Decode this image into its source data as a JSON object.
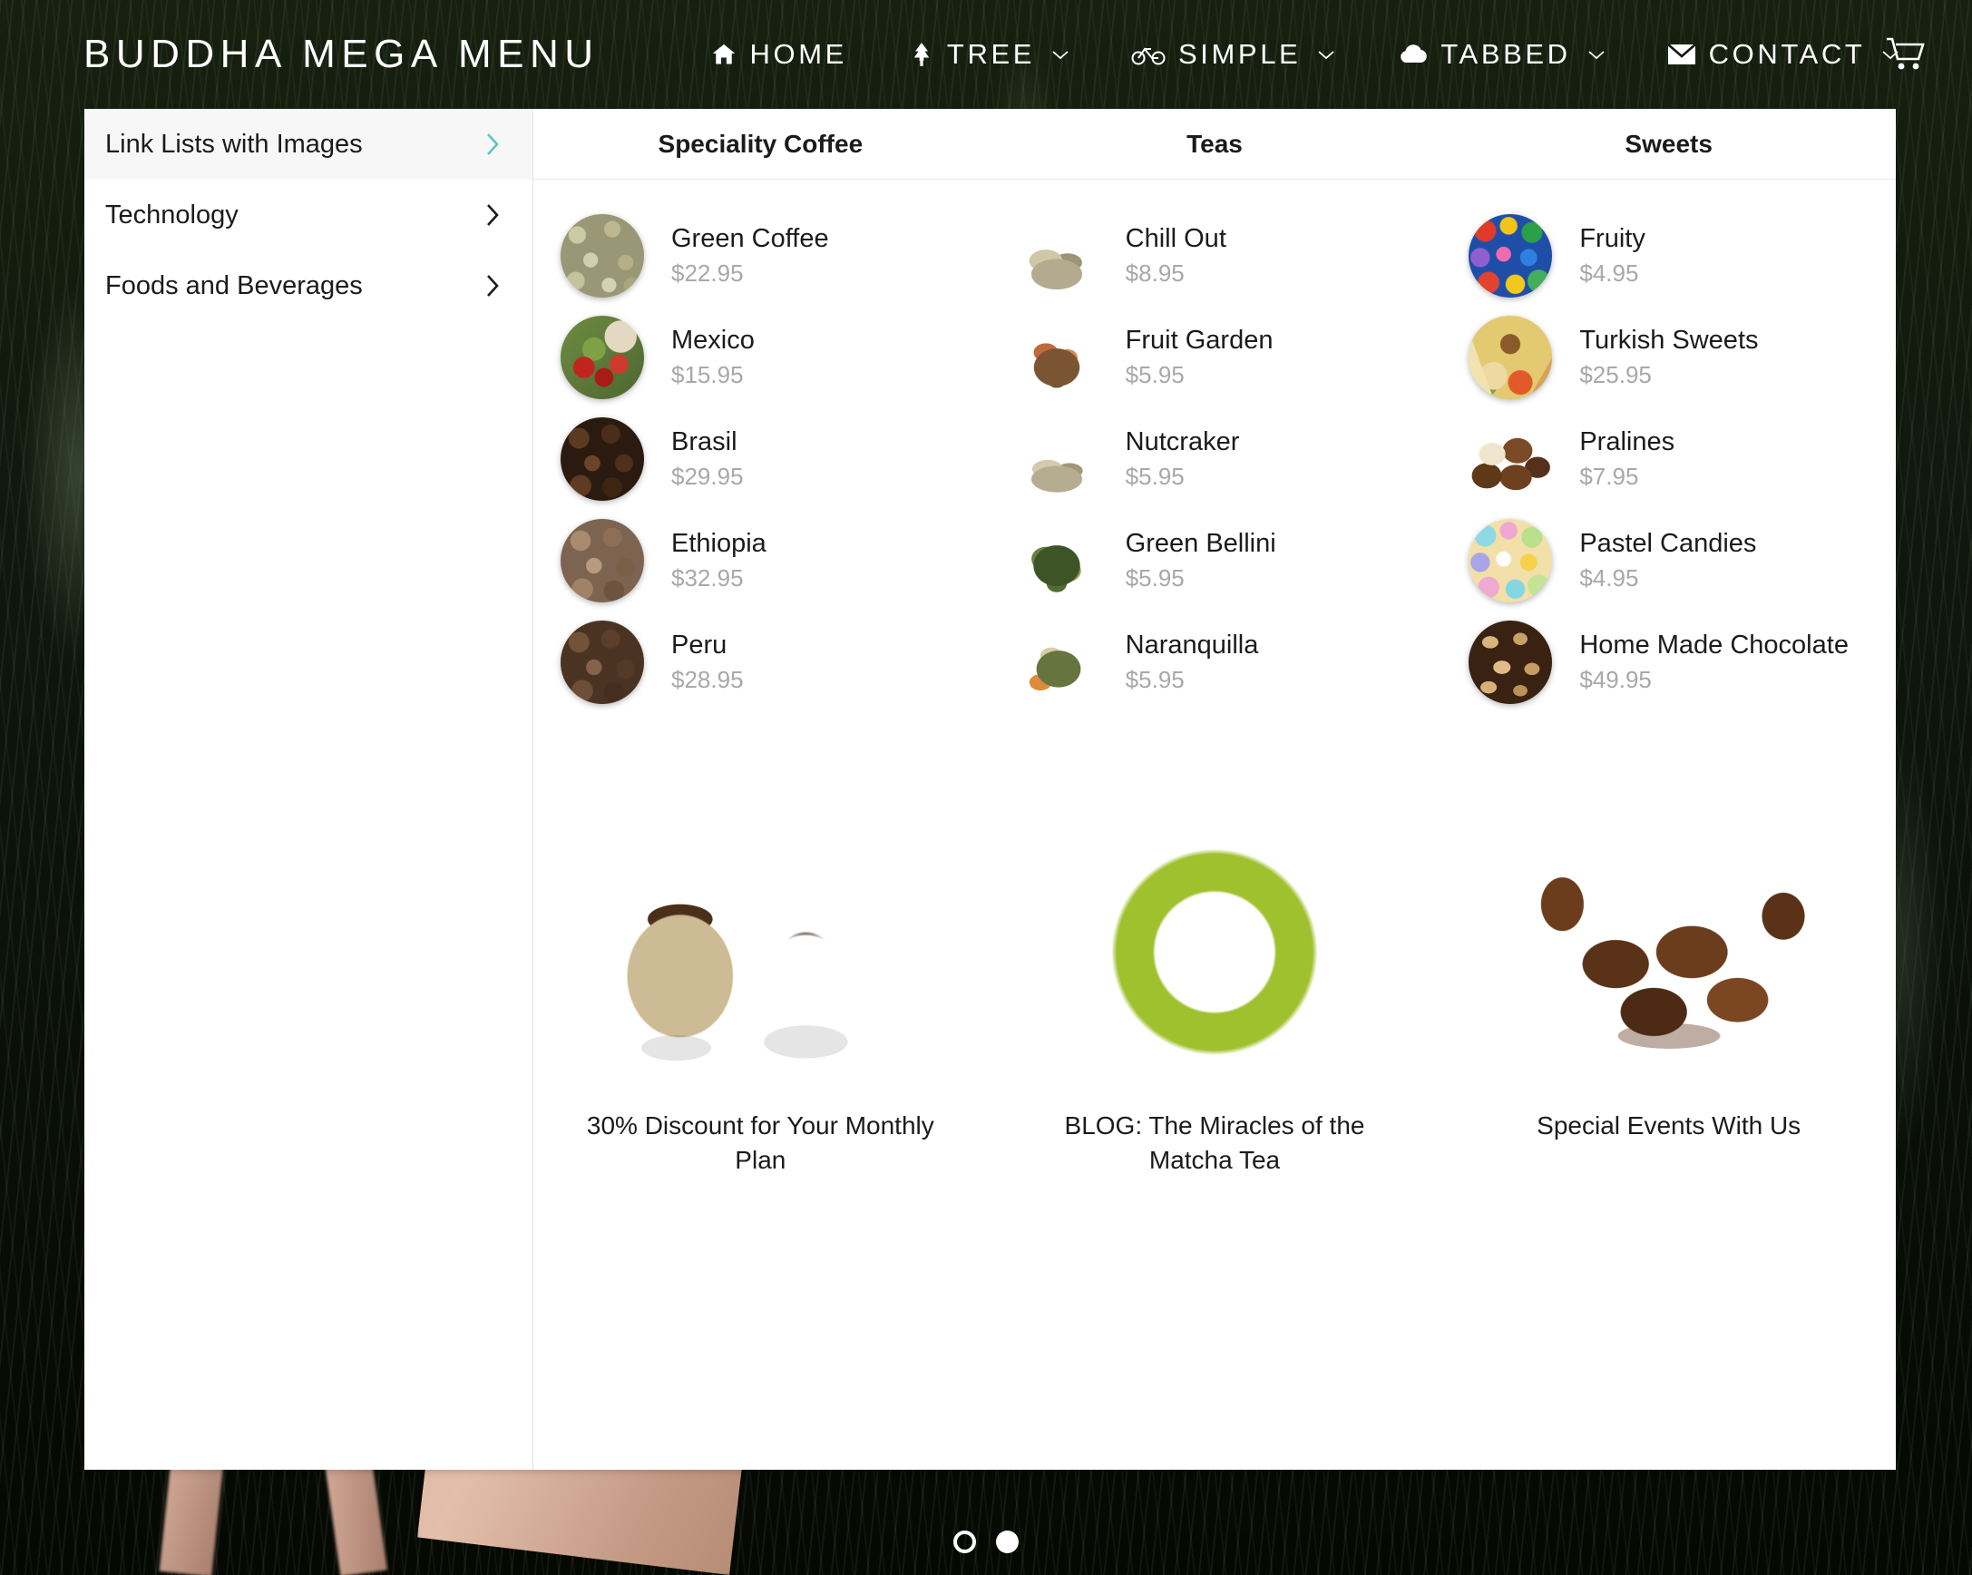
{
  "header": {
    "brand": "BUDDHA MEGA MENU",
    "nav": [
      {
        "label": "HOME",
        "icon": "home-icon",
        "caret": false
      },
      {
        "label": "TREE",
        "icon": "tree-icon",
        "caret": true
      },
      {
        "label": "SIMPLE",
        "icon": "bicycle-icon",
        "caret": true
      },
      {
        "label": "TABBED",
        "icon": "cloud-icon",
        "caret": true
      },
      {
        "label": "CONTACT",
        "icon": "envelope-icon",
        "caret": true
      }
    ],
    "cart_icon": "shopping-cart-icon"
  },
  "mega_menu": {
    "sidebar": [
      {
        "label": "Link Lists with Images",
        "active": true,
        "chevron": "chevron-right-icon"
      },
      {
        "label": "Technology",
        "active": false,
        "chevron": "chevron-right-icon"
      },
      {
        "label": "Foods and Beverages",
        "active": false,
        "chevron": "chevron-right-icon"
      }
    ],
    "columns": [
      {
        "heading": "Speciality Coffee",
        "items": [
          {
            "name": "Green Coffee",
            "price": "$22.95",
            "image": "green-coffee-beans"
          },
          {
            "name": "Mexico",
            "price": "$15.95",
            "image": "mexico-coffee-cherries"
          },
          {
            "name": "Brasil",
            "price": "$29.95",
            "image": "brasil-dark-roast-beans"
          },
          {
            "name": "Ethiopia",
            "price": "$32.95",
            "image": "ethiopia-light-roast-beans"
          },
          {
            "name": "Peru",
            "price": "$28.95",
            "image": "peru-roasted-beans"
          }
        ]
      },
      {
        "heading": "Teas",
        "items": [
          {
            "name": "Chill Out",
            "price": "$8.95",
            "image": "chill-out-tea-leaves"
          },
          {
            "name": "Fruit Garden",
            "price": "$5.95",
            "image": "fruit-garden-tea-blend"
          },
          {
            "name": "Nutcraker",
            "price": "$5.95",
            "image": "nutcraker-tea-leaves"
          },
          {
            "name": "Green Bellini",
            "price": "$5.95",
            "image": "green-bellini-tea-leaves"
          },
          {
            "name": "Naranquilla",
            "price": "$5.95",
            "image": "naranquilla-tea-blend"
          }
        ]
      },
      {
        "heading": "Sweets",
        "items": [
          {
            "name": "Fruity",
            "price": "$4.95",
            "image": "fruity-candy-balls"
          },
          {
            "name": "Turkish Sweets",
            "price": "$25.95",
            "image": "turkish-sweets-platter"
          },
          {
            "name": "Pralines",
            "price": "$7.95",
            "image": "pralines-chocolates"
          },
          {
            "name": "Pastel Candies",
            "price": "$4.95",
            "image": "pastel-candy-balls"
          },
          {
            "name": "Home Made Chocolate",
            "price": "$49.95",
            "image": "homemade-walnut-chocolate"
          }
        ]
      }
    ],
    "promos": [
      {
        "caption": "30% Discount for Your Monthly Plan",
        "image": "coffee-sack-and-cup"
      },
      {
        "caption": "BLOG: The Miracles of the Matcha Tea",
        "image": "matcha-powder-bowl"
      },
      {
        "caption": "Special Events With Us",
        "image": "chocolate-truffles-splash"
      }
    ]
  },
  "carousel": {
    "dots": [
      {
        "state": "hollow"
      },
      {
        "state": "filled"
      }
    ]
  },
  "colors": {
    "accent_teal": "#5bc6c6",
    "panel_white": "#ffffff",
    "active_row": "#f7f7f7",
    "price_gray": "#a8a8a8",
    "text_dark": "#1b1b1b"
  }
}
